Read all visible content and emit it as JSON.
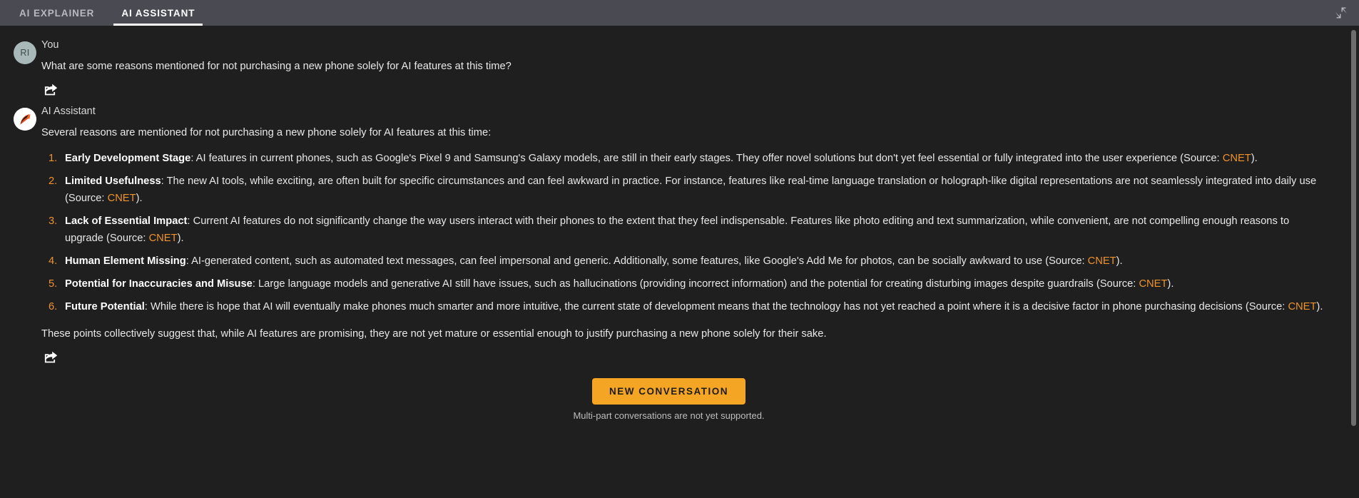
{
  "tabs": [
    {
      "id": "ai-explainer",
      "label": "AI EXPLAINER",
      "active": false
    },
    {
      "id": "ai-assistant",
      "label": "AI ASSISTANT",
      "active": true
    }
  ],
  "header": {
    "collapse_icon": "collapse-arrows-icon",
    "accent_color": "#f0932b",
    "tabbar_background": "#4a4a53"
  },
  "conversation": {
    "user": {
      "avatar_initials": "RI",
      "sender": "You",
      "message": "What are some reasons mentioned for not purchasing a new phone solely for AI features at this time?",
      "share_icon": "share-arrow-icon"
    },
    "assistant": {
      "avatar_icon": "cnet-swoosh-icon",
      "sender": "AI Assistant",
      "intro": "Several reasons are mentioned for not purchasing a new phone solely for AI features at this time:",
      "reasons": [
        {
          "number": "1.",
          "lead": "Early Development Stage",
          "body_before": ": AI features in current phones, such as Google's Pixel 9 and Samsung's Galaxy models, are still in their early stages. They offer novel solutions but don't yet feel essential or fully integrated into the user experience (Source: ",
          "source": "CNET",
          "body_after": ")."
        },
        {
          "number": "2.",
          "lead": "Limited Usefulness",
          "body_before": ": The new AI tools, while exciting, are often built for specific circumstances and can feel awkward in practice. For instance, features like real-time language translation or holograph-like digital representations are not seamlessly integrated into daily use (Source: ",
          "source": "CNET",
          "body_after": ")."
        },
        {
          "number": "3.",
          "lead": "Lack of Essential Impact",
          "body_before": ": Current AI features do not significantly change the way users interact with their phones to the extent that they feel indispensable. Features like photo editing and text summarization, while convenient, are not compelling enough reasons to upgrade (Source: ",
          "source": "CNET",
          "body_after": ")."
        },
        {
          "number": "4.",
          "lead": "Human Element Missing",
          "body_before": ": AI-generated content, such as automated text messages, can feel impersonal and generic. Additionally, some features, like Google's Add Me for photos, can be socially awkward to use (Source: ",
          "source": "CNET",
          "body_after": ")."
        },
        {
          "number": "5.",
          "lead": "Potential for Inaccuracies and Misuse",
          "body_before": ": Large language models and generative AI still have issues, such as hallucinations (providing incorrect information) and the potential for creating disturbing images despite guardrails (Source: ",
          "source": "CNET",
          "body_after": ")."
        },
        {
          "number": "6.",
          "lead": "Future Potential",
          "body_before": ": While there is hope that AI will eventually make phones much smarter and more intuitive, the current state of development means that the technology has not yet reached a point where it is a decisive factor in phone purchasing decisions (Source: ",
          "source": "CNET",
          "body_after": ")."
        }
      ],
      "outro": "These points collectively suggest that, while AI features are promising, they are not yet mature or essential enough to justify purchasing a new phone solely for their sake.",
      "share_icon": "share-arrow-icon"
    }
  },
  "footer": {
    "new_conversation_label": "NEW CONVERSATION",
    "note": "Multi-part conversations are not yet supported.",
    "button_color": "#f5a524"
  }
}
